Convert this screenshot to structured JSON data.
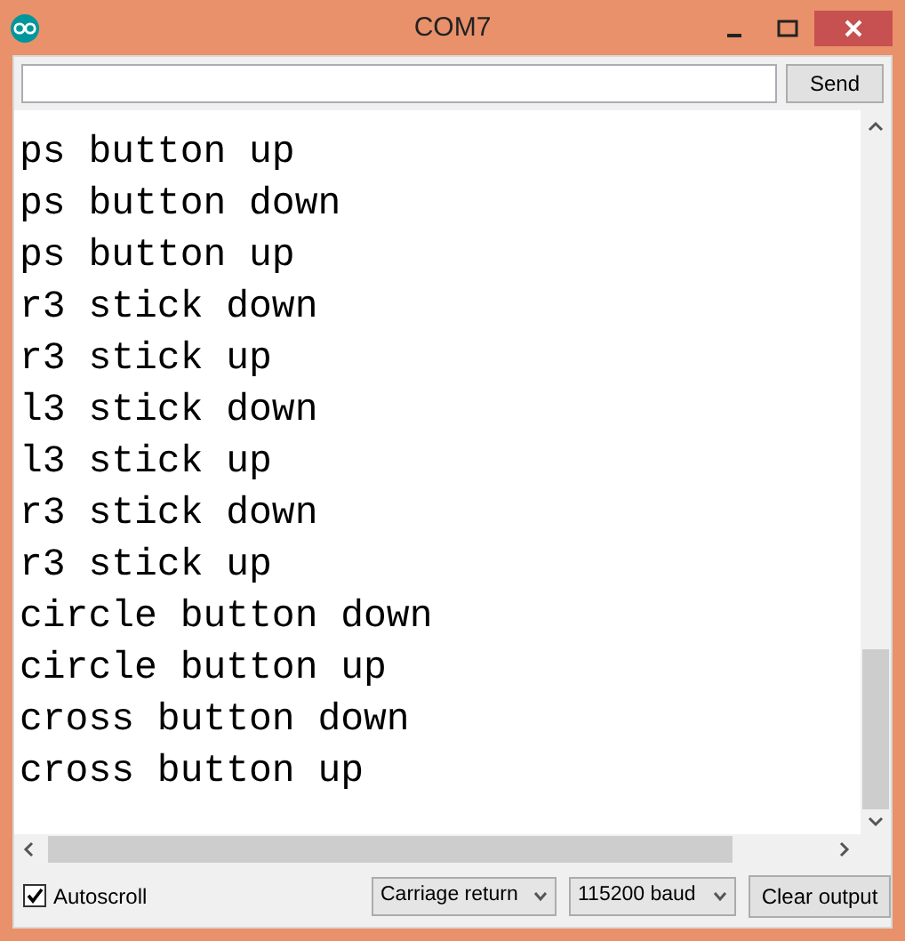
{
  "window": {
    "title": "COM7"
  },
  "send_button": "Send",
  "output_lines": [
    "ps button up",
    "ps button down",
    "ps button up",
    "r3 stick down",
    "r3 stick up",
    "l3 stick down",
    "l3 stick up",
    "r3 stick down",
    "r3 stick up",
    "circle button down",
    "circle button up",
    "cross button down",
    "cross button up"
  ],
  "autoscroll": {
    "label": "Autoscroll",
    "checked": true
  },
  "line_ending": "Carriage return",
  "baud_rate": "115200 baud",
  "clear_button": "Clear output"
}
